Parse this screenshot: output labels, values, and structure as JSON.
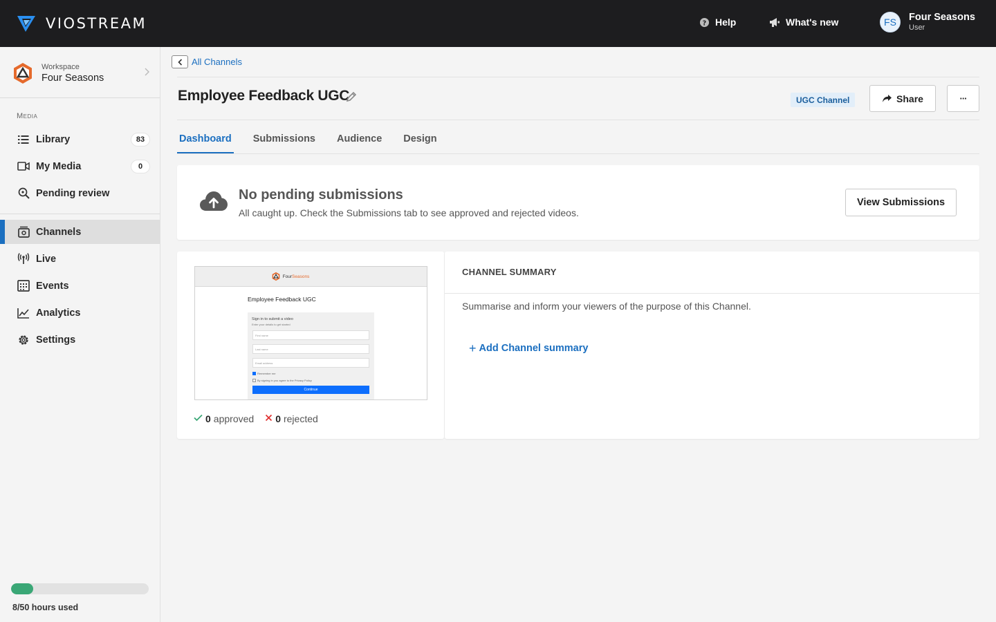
{
  "brand": {
    "name": "VIOSTREAM"
  },
  "header": {
    "help_label": "Help",
    "whats_new_label": "What's new",
    "user": {
      "initials": "FS",
      "name": "Four Seasons",
      "role": "User"
    }
  },
  "sidebar": {
    "workspace": {
      "label": "Workspace",
      "name": "Four Seasons"
    },
    "media_heading": "Media",
    "media_items": [
      {
        "label": "Library",
        "badge": "83",
        "icon": "list-icon"
      },
      {
        "label": "My Media",
        "badge": "0",
        "icon": "video-icon"
      },
      {
        "label": "Pending review",
        "icon": "search-icon"
      }
    ],
    "main_items": [
      {
        "label": "Channels",
        "icon": "channels-icon",
        "active": true
      },
      {
        "label": "Live",
        "icon": "broadcast-icon"
      },
      {
        "label": "Events",
        "icon": "calendar-icon"
      },
      {
        "label": "Analytics",
        "icon": "chart-icon"
      },
      {
        "label": "Settings",
        "icon": "gear-icon"
      }
    ],
    "usage": {
      "text": "8/50 hours used",
      "used": 8,
      "total": 50
    }
  },
  "breadcrumb": {
    "back_label": "All Channels"
  },
  "channel": {
    "title": "Employee Feedback UGC",
    "type_tag": "UGC Channel",
    "share_label": "Share",
    "more_label": "···"
  },
  "tabs": [
    {
      "label": "Dashboard",
      "active": true
    },
    {
      "label": "Submissions"
    },
    {
      "label": "Audience"
    },
    {
      "label": "Design"
    }
  ],
  "pending": {
    "title": "No pending submissions",
    "subtitle": "All caught up. Check the Submissions tab to see approved and rejected videos.",
    "button_label": "View Submissions"
  },
  "preview": {
    "brand_a": "Four",
    "brand_b": "Seasons",
    "title": "Employee Feedback UGC",
    "form_title": "Sign in to submit a video",
    "form_sub": "Enter your details to get started",
    "first_name": "First name",
    "last_name": "Last name",
    "email": "Email address",
    "remember": "Remember me",
    "agree": "By signing in you agree to the Privacy Policy",
    "continue": "Continue"
  },
  "counts": {
    "approved": "0",
    "approved_label": "approved",
    "rejected": "0",
    "rejected_label": "rejected"
  },
  "summary": {
    "heading": "CHANNEL SUMMARY",
    "text": "Summarise and inform your viewers of the purpose of this Channel.",
    "add_label": "Add Channel summary"
  },
  "colors": {
    "accent": "#1b6fc0",
    "topbar": "#1d1d1f",
    "usage_fill": "#3aa776"
  }
}
